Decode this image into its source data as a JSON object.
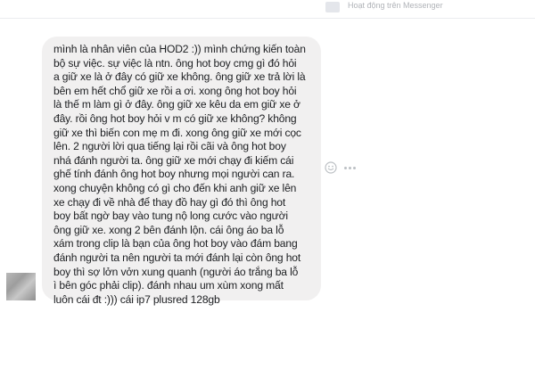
{
  "header": {
    "status_text": "Hoạt động trên Messenger"
  },
  "message": {
    "lines": [
      "mình là nhân viên của HOD2 :)) mình chứng kiến toàn",
      "bộ sự việc. sự việc là ntn. ông hot boy cmg gì đó hỏi",
      "a giữ xe là ở đây có giữ xe không. ông giữ xe trả lời là",
      "bên em hết chổ giữ xe rồi a ơi. xong ông hot boy hỏi",
      "là thế m làm gì ở đây. ông giữ xe kêu da em giữ xe ở",
      "đây. rồi ông hot boy hỏi v m có giữ xe không? không",
      "giữ xe thì biến con mẹ m đi. xong ông giữ xe mới cọc",
      "lên. 2 người lời qua tiếng lại rồi cãi và ông hot boy",
      "nhá đánh người ta. ông giữ xe mới chạy đi kiếm cái",
      "ghế tính đánh ông hot boy nhưng mọi người can ra.",
      "xong chuyện không có gì cho đến khi anh giữ xe lên",
      "xe chạy đi về nhà để thay đồ hay gì đó thì ông hot",
      "boy bất ngờ bay vào tung nộ long cước vào người",
      "ông giữ xe. xong 2 bên đánh lộn. cái ông áo ba lỗ",
      "xám trong clip là bạn của ông hot boy vào đám bang",
      "đánh người ta nên người ta mới đánh lại còn ông hot",
      "boy thì sợ lởn vởn xung quanh (người áo trắng ba lỗ",
      "ì bên góc phải clip). đánh nhau um xùm xong mất",
      "luôn cái đt :))) cái ip7 plusred 128gb"
    ]
  },
  "icons": {
    "emoji": "smiley-icon",
    "more": "more-dots-icon"
  },
  "colors": {
    "bubble": "#f1f0f0",
    "text": "#1c1e21",
    "status": "#b0b3b8"
  }
}
